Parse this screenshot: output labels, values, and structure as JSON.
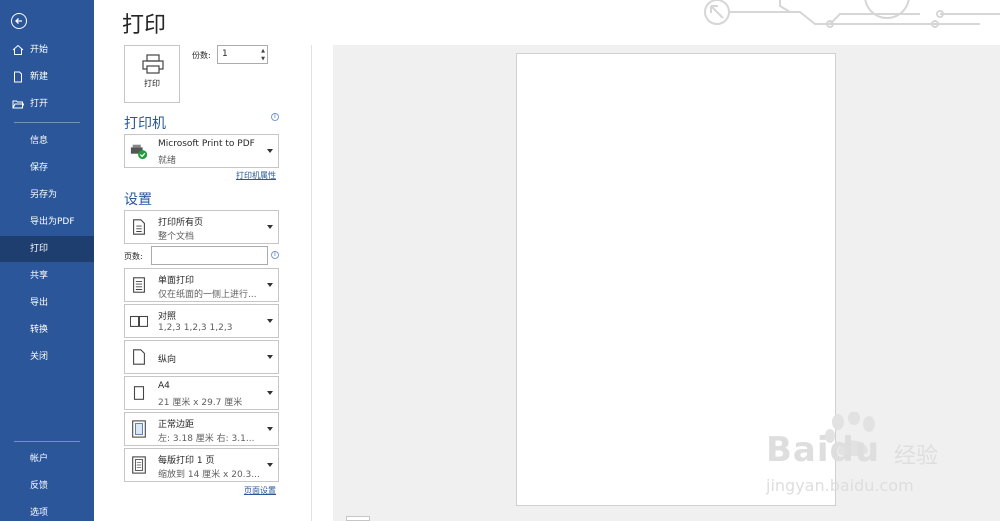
{
  "sidebar": {
    "top_items": [
      {
        "label": "开始",
        "icon": "home-icon"
      },
      {
        "label": "新建",
        "icon": "new-document-icon"
      },
      {
        "label": "打开",
        "icon": "open-folder-icon"
      }
    ],
    "sub_items": [
      {
        "label": "信息"
      },
      {
        "label": "保存"
      },
      {
        "label": "另存为"
      },
      {
        "label": "导出为PDF"
      },
      {
        "label": "打印"
      },
      {
        "label": "共享"
      },
      {
        "label": "导出"
      },
      {
        "label": "转换"
      },
      {
        "label": "关闭"
      }
    ],
    "bottom_items": [
      {
        "label": "帐户"
      },
      {
        "label": "反馈"
      },
      {
        "label": "选项"
      }
    ],
    "active_item": "打印",
    "colors": {
      "bg": "#2b579a",
      "active": "#1e3e6f"
    }
  },
  "header": {
    "title": "打印"
  },
  "print_panel": {
    "print_button_label": "打印",
    "copies_label": "份数:",
    "copies_value": "1",
    "printer_section_title": "打印机",
    "printer": {
      "name": "Microsoft Print to PDF",
      "status": "就绪"
    },
    "printer_properties_link": "打印机属性",
    "settings_section_title": "设置",
    "settings": [
      {
        "name": "print-range",
        "main": "打印所有页",
        "sub": "整个文档"
      },
      {
        "name": "sides",
        "main": "单面打印",
        "sub": "仅在纸面的一侧上进行..."
      },
      {
        "name": "collation",
        "main": "对照",
        "sub": "1,2,3    1,2,3    1,2,3"
      },
      {
        "name": "orientation",
        "main": "纵向",
        "sub": ""
      },
      {
        "name": "paper-size",
        "main": "A4",
        "sub": "21 厘米 x 29.7 厘米"
      },
      {
        "name": "margins",
        "main": "正常边距",
        "sub": "左: 3.18 厘米    右: 3.1..."
      },
      {
        "name": "pages-per-sheet",
        "main": "每版打印 1 页",
        "sub": "缩放到 14 厘米 x 20.3..."
      }
    ],
    "pages_label": "页数:",
    "pages_value": "",
    "page_setup_link": "页面设置"
  },
  "watermark": {
    "brand": "Baidu",
    "cn": "经验",
    "url": "jingyan.baidu.com"
  }
}
